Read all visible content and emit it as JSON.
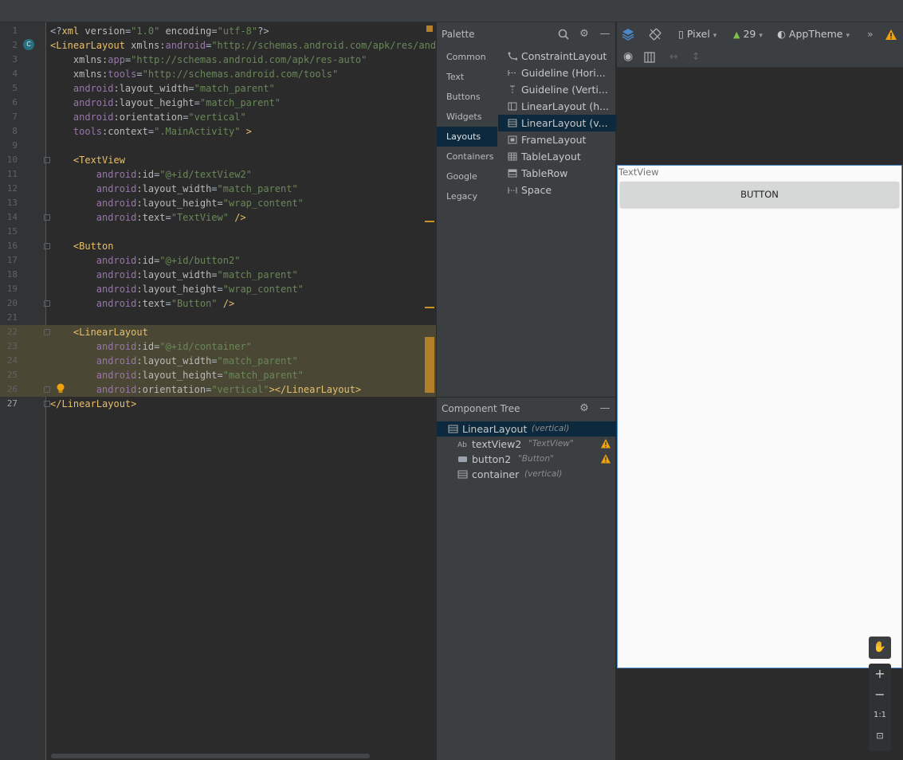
{
  "editor": {
    "lines": [
      {
        "n": "1",
        "parts": [
          [
            "punc",
            "<?"
          ],
          [
            "tag",
            "xml"
          ],
          [
            "attr",
            " version"
          ],
          [
            "punc",
            "="
          ],
          [
            "val",
            "\"1.0\""
          ],
          [
            "attr",
            " encoding"
          ],
          [
            "punc",
            "="
          ],
          [
            "val",
            "\"utf-8\""
          ],
          [
            "punc",
            "?>"
          ]
        ]
      },
      {
        "n": "2",
        "parts": [
          [
            "tag",
            "<LinearLayout"
          ],
          [
            "attr",
            " xmlns:"
          ],
          [
            "ns",
            "android"
          ],
          [
            "punc",
            "="
          ],
          [
            "val",
            "\"http://schemas.android.com/apk/res/andro"
          ]
        ]
      },
      {
        "n": "3",
        "parts": [
          [
            "attr",
            "    xmlns:"
          ],
          [
            "ns",
            "app"
          ],
          [
            "punc",
            "="
          ],
          [
            "val",
            "\"http://schemas.android.com/apk/res-auto\""
          ]
        ]
      },
      {
        "n": "4",
        "parts": [
          [
            "attr",
            "    xmlns:"
          ],
          [
            "ns",
            "tools"
          ],
          [
            "punc",
            "="
          ],
          [
            "val",
            "\"http://schemas.android.com/tools\""
          ]
        ]
      },
      {
        "n": "5",
        "parts": [
          [
            "ns",
            "    android"
          ],
          [
            "attr",
            ":layout_width"
          ],
          [
            "punc",
            "="
          ],
          [
            "val",
            "\"match_parent\""
          ]
        ]
      },
      {
        "n": "6",
        "parts": [
          [
            "ns",
            "    android"
          ],
          [
            "attr",
            ":layout_height"
          ],
          [
            "punc",
            "="
          ],
          [
            "val",
            "\"match_parent\""
          ]
        ]
      },
      {
        "n": "7",
        "parts": [
          [
            "ns",
            "    android"
          ],
          [
            "attr",
            ":orientation"
          ],
          [
            "punc",
            "="
          ],
          [
            "val",
            "\"vertical\""
          ]
        ]
      },
      {
        "n": "8",
        "parts": [
          [
            "ns",
            "    tools"
          ],
          [
            "attr",
            ":context"
          ],
          [
            "punc",
            "="
          ],
          [
            "val",
            "\".MainActivity\""
          ],
          [
            "tag",
            " >"
          ]
        ]
      },
      {
        "n": "9",
        "parts": []
      },
      {
        "n": "10",
        "parts": [
          [
            "tag",
            "    <TextView"
          ]
        ]
      },
      {
        "n": "11",
        "parts": [
          [
            "ns",
            "        android"
          ],
          [
            "attr",
            ":id"
          ],
          [
            "punc",
            "="
          ],
          [
            "val",
            "\"@+id/textView2\""
          ]
        ]
      },
      {
        "n": "12",
        "parts": [
          [
            "ns",
            "        android"
          ],
          [
            "attr",
            ":layout_width"
          ],
          [
            "punc",
            "="
          ],
          [
            "val",
            "\"match_parent\""
          ]
        ]
      },
      {
        "n": "13",
        "parts": [
          [
            "ns",
            "        android"
          ],
          [
            "attr",
            ":layout_height"
          ],
          [
            "punc",
            "="
          ],
          [
            "val",
            "\"wrap_content\""
          ]
        ]
      },
      {
        "n": "14",
        "parts": [
          [
            "ns",
            "        android"
          ],
          [
            "attr",
            ":text"
          ],
          [
            "punc",
            "="
          ],
          [
            "val",
            "\"TextView\""
          ],
          [
            "tag",
            " />"
          ]
        ]
      },
      {
        "n": "15",
        "parts": []
      },
      {
        "n": "16",
        "parts": [
          [
            "tag",
            "    <Button"
          ]
        ]
      },
      {
        "n": "17",
        "parts": [
          [
            "ns",
            "        android"
          ],
          [
            "attr",
            ":id"
          ],
          [
            "punc",
            "="
          ],
          [
            "val",
            "\"@+id/button2\""
          ]
        ]
      },
      {
        "n": "18",
        "parts": [
          [
            "ns",
            "        android"
          ],
          [
            "attr",
            ":layout_width"
          ],
          [
            "punc",
            "="
          ],
          [
            "val",
            "\"match_parent\""
          ]
        ]
      },
      {
        "n": "19",
        "parts": [
          [
            "ns",
            "        android"
          ],
          [
            "attr",
            ":layout_height"
          ],
          [
            "punc",
            "="
          ],
          [
            "val",
            "\"wrap_content\""
          ]
        ]
      },
      {
        "n": "20",
        "parts": [
          [
            "ns",
            "        android"
          ],
          [
            "attr",
            ":text"
          ],
          [
            "punc",
            "="
          ],
          [
            "val",
            "\"Button\""
          ],
          [
            "tag",
            " />"
          ]
        ]
      },
      {
        "n": "21",
        "parts": []
      },
      {
        "n": "22",
        "parts": [
          [
            "tag",
            "    <LinearLayout"
          ]
        ]
      },
      {
        "n": "23",
        "parts": [
          [
            "ns",
            "        android"
          ],
          [
            "attr",
            ":id"
          ],
          [
            "punc",
            "="
          ],
          [
            "val",
            "\"@+id/container\""
          ]
        ]
      },
      {
        "n": "24",
        "parts": [
          [
            "ns",
            "        android"
          ],
          [
            "attr",
            ":layout_width"
          ],
          [
            "punc",
            "="
          ],
          [
            "val",
            "\"match_parent\""
          ]
        ]
      },
      {
        "n": "25",
        "parts": [
          [
            "ns",
            "        android"
          ],
          [
            "attr",
            ":layout_height"
          ],
          [
            "punc",
            "="
          ],
          [
            "val",
            "\"match_parent\""
          ]
        ]
      },
      {
        "n": "26",
        "parts": [
          [
            "ns",
            "        android"
          ],
          [
            "attr",
            ":orientation"
          ],
          [
            "punc",
            "="
          ],
          [
            "val",
            "\"vertical\""
          ],
          [
            "tag",
            "></LinearLayout>"
          ]
        ]
      },
      {
        "n": "27",
        "parts": [
          [
            "tag",
            "</LinearLayout>"
          ]
        ]
      }
    ],
    "highlighted_lines": [
      22,
      23,
      24,
      25,
      26
    ],
    "current_line": 27
  },
  "palette": {
    "title": "Palette",
    "categories": [
      "Common",
      "Text",
      "Buttons",
      "Widgets",
      "Layouts",
      "Containers",
      "Google",
      "Legacy"
    ],
    "selected_category": "Layouts",
    "items": [
      {
        "label": "ConstraintLayout",
        "icon": "constraint-layout-icon"
      },
      {
        "label": "Guideline (Hori...",
        "icon": "guideline-horizontal-icon"
      },
      {
        "label": "Guideline (Verti...",
        "icon": "guideline-vertical-icon"
      },
      {
        "label": "LinearLayout (h...",
        "icon": "linear-layout-horizontal-icon"
      },
      {
        "label": "LinearLayout (v...",
        "icon": "linear-layout-vertical-icon"
      },
      {
        "label": "FrameLayout",
        "icon": "frame-layout-icon"
      },
      {
        "label": "TableLayout",
        "icon": "table-layout-icon"
      },
      {
        "label": "TableRow",
        "icon": "table-row-icon"
      },
      {
        "label": "Space",
        "icon": "space-icon"
      }
    ],
    "selected_item": "LinearLayout (v..."
  },
  "component_tree": {
    "title": "Component Tree",
    "nodes": [
      {
        "label": "LinearLayout",
        "sub": "(vertical)",
        "warning": false
      },
      {
        "label": "textView2",
        "sub": "\"TextView\"",
        "warning": true
      },
      {
        "label": "button2",
        "sub": "\"Button\"",
        "warning": true
      },
      {
        "label": "container",
        "sub": "(vertical)",
        "warning": false
      }
    ]
  },
  "design_toolbar": {
    "device": "Pixel",
    "api": "29",
    "theme": "AppTheme"
  },
  "preview": {
    "textview_text": "TextView",
    "button_text": "BUTTON"
  },
  "zoom": {
    "in": "+",
    "out": "−",
    "one_to_one": "1:1"
  },
  "colors": {
    "accent": "#4a88c7",
    "warning": "#f0a30a",
    "selection": "#0d293e"
  }
}
